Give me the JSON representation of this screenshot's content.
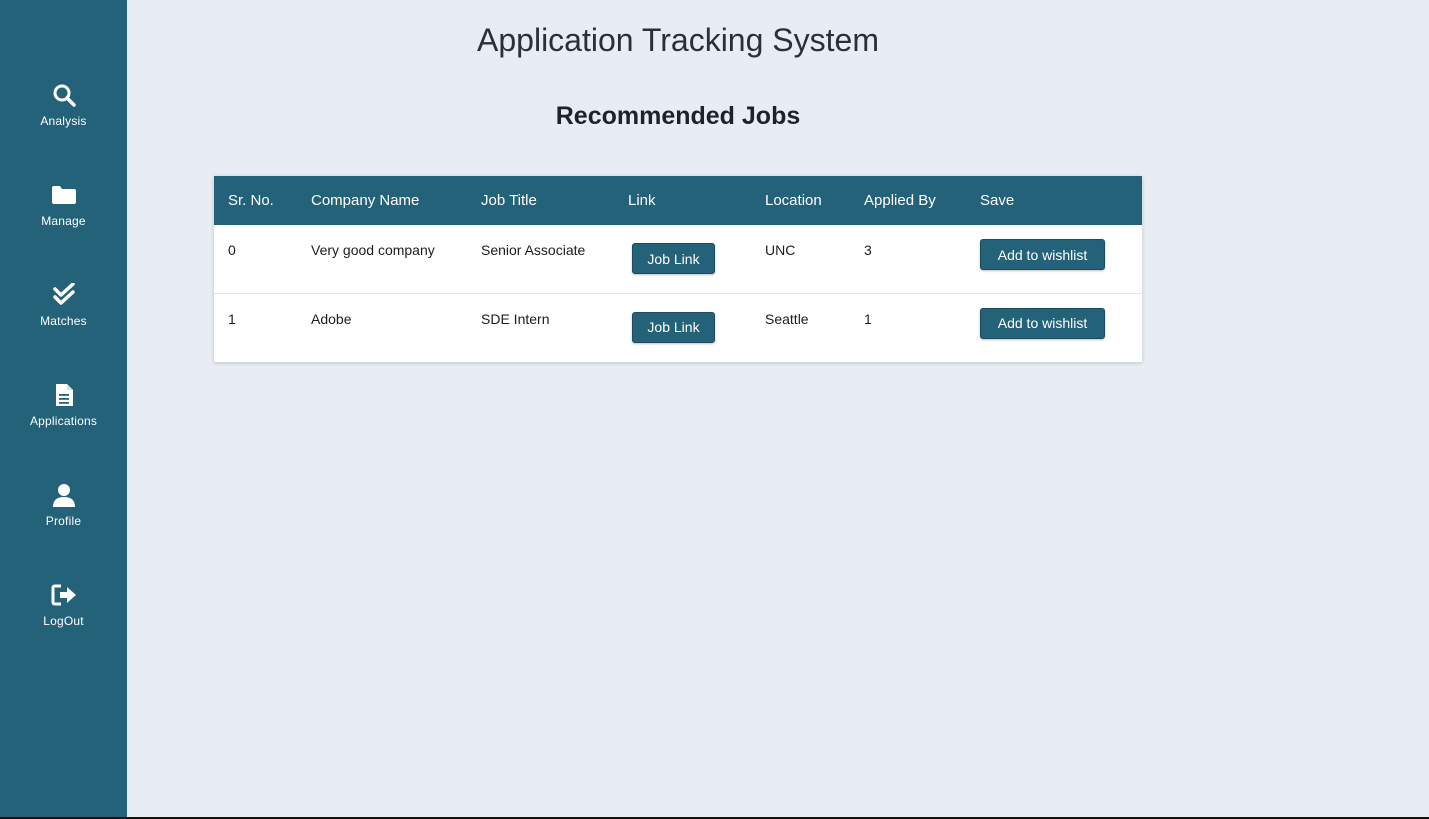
{
  "sidebar": {
    "items": [
      {
        "label": "Analysis",
        "icon": "search-icon"
      },
      {
        "label": "Manage",
        "icon": "folder-icon"
      },
      {
        "label": "Matches",
        "icon": "double-check-icon"
      },
      {
        "label": "Applications",
        "icon": "file-text-icon"
      },
      {
        "label": "Profile",
        "icon": "user-icon"
      },
      {
        "label": "LogOut",
        "icon": "logout-icon"
      }
    ]
  },
  "header": {
    "title": "Application Tracking System"
  },
  "main": {
    "section_title": "Recommended Jobs",
    "table": {
      "columns": [
        "Sr. No.",
        "Company Name",
        "Job Title",
        "Link",
        "Location",
        "Applied By",
        "Save"
      ],
      "rows": [
        {
          "sr_no": "0",
          "company": "Very good company",
          "job_title": "Senior Associate",
          "link_label": "Job Link",
          "location": "UNC",
          "applied_by": "3",
          "save_label": "Add to wishlist"
        },
        {
          "sr_no": "1",
          "company": "Adobe",
          "job_title": "SDE Intern",
          "link_label": "Job Link",
          "location": "Seattle",
          "applied_by": "1",
          "save_label": "Add to wishlist"
        }
      ]
    }
  },
  "colors": {
    "sidebar_bg": "#236279",
    "page_bg": "#e8edf4",
    "button_bg": "#236279"
  }
}
